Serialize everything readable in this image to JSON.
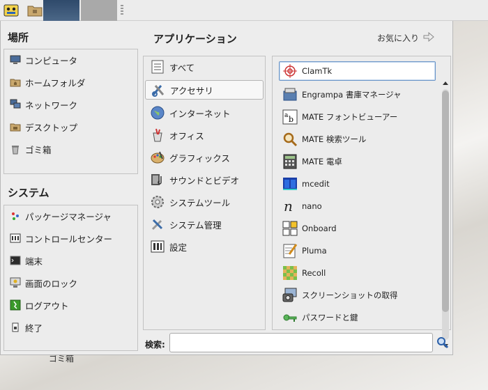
{
  "top_panel": {
    "menu_button_icon": "mate-menu-icon",
    "folder_icon": "folder-icon",
    "window_thumb_icon": "window-thumbnail-icon"
  },
  "desktop": {
    "trash_label": "ゴミ箱"
  },
  "places": {
    "title": "場所",
    "items": [
      {
        "label": "コンピュータ",
        "icon": "computer-icon"
      },
      {
        "label": "ホームフォルダ",
        "icon": "home-folder-icon"
      },
      {
        "label": "ネットワーク",
        "icon": "network-icon"
      },
      {
        "label": "デスクトップ",
        "icon": "desktop-folder-icon"
      },
      {
        "label": "ゴミ箱",
        "icon": "trash-icon"
      }
    ]
  },
  "system": {
    "title": "システム",
    "items": [
      {
        "label": "パッケージマネージャ",
        "icon": "package-manager-icon"
      },
      {
        "label": "コントロールセンター",
        "icon": "control-center-icon"
      },
      {
        "label": "端末",
        "icon": "terminal-icon"
      },
      {
        "label": "画面のロック",
        "icon": "lock-screen-icon"
      },
      {
        "label": "ログアウト",
        "icon": "logout-icon"
      },
      {
        "label": "終了",
        "icon": "shutdown-icon"
      }
    ]
  },
  "applications": {
    "title": "アプリケーション",
    "favorites_label": "お気に入り",
    "categories": [
      {
        "label": "すべて",
        "icon": "all-apps-icon"
      },
      {
        "label": "アクセサリ",
        "icon": "accessories-icon",
        "selected": true
      },
      {
        "label": "インターネット",
        "icon": "internet-globe-icon"
      },
      {
        "label": "オフィス",
        "icon": "office-icon"
      },
      {
        "label": "グラフィックス",
        "icon": "graphics-palette-icon"
      },
      {
        "label": "サウンドとビデオ",
        "icon": "sound-video-icon"
      },
      {
        "label": "システムツール",
        "icon": "system-tools-gear-icon"
      },
      {
        "label": "システム管理",
        "icon": "system-admin-tools-icon"
      },
      {
        "label": "設定",
        "icon": "settings-icon"
      }
    ],
    "apps": [
      {
        "label": "ClamTk",
        "icon": "clamtk-target-icon",
        "selected": true
      },
      {
        "label": "Engrampa 書庫マネージャ",
        "icon": "archive-manager-icon"
      },
      {
        "label": "MATE フォントビューアー",
        "icon": "font-viewer-icon"
      },
      {
        "label": "MATE 検索ツール",
        "icon": "search-tool-icon"
      },
      {
        "label": "MATE 電卓",
        "icon": "calculator-icon"
      },
      {
        "label": "mcedit",
        "icon": "mcedit-icon"
      },
      {
        "label": "nano",
        "icon": "nano-icon"
      },
      {
        "label": "Onboard",
        "icon": "onboard-keyboard-icon"
      },
      {
        "label": "Pluma",
        "icon": "pluma-editor-icon"
      },
      {
        "label": "Recoll",
        "icon": "recoll-icon"
      },
      {
        "label": "スクリーンショットの取得",
        "icon": "screenshot-icon"
      },
      {
        "label": "パスワードと鍵",
        "icon": "passwords-keys-icon"
      }
    ]
  },
  "search": {
    "label": "検索:",
    "value": "",
    "placeholder": ""
  }
}
